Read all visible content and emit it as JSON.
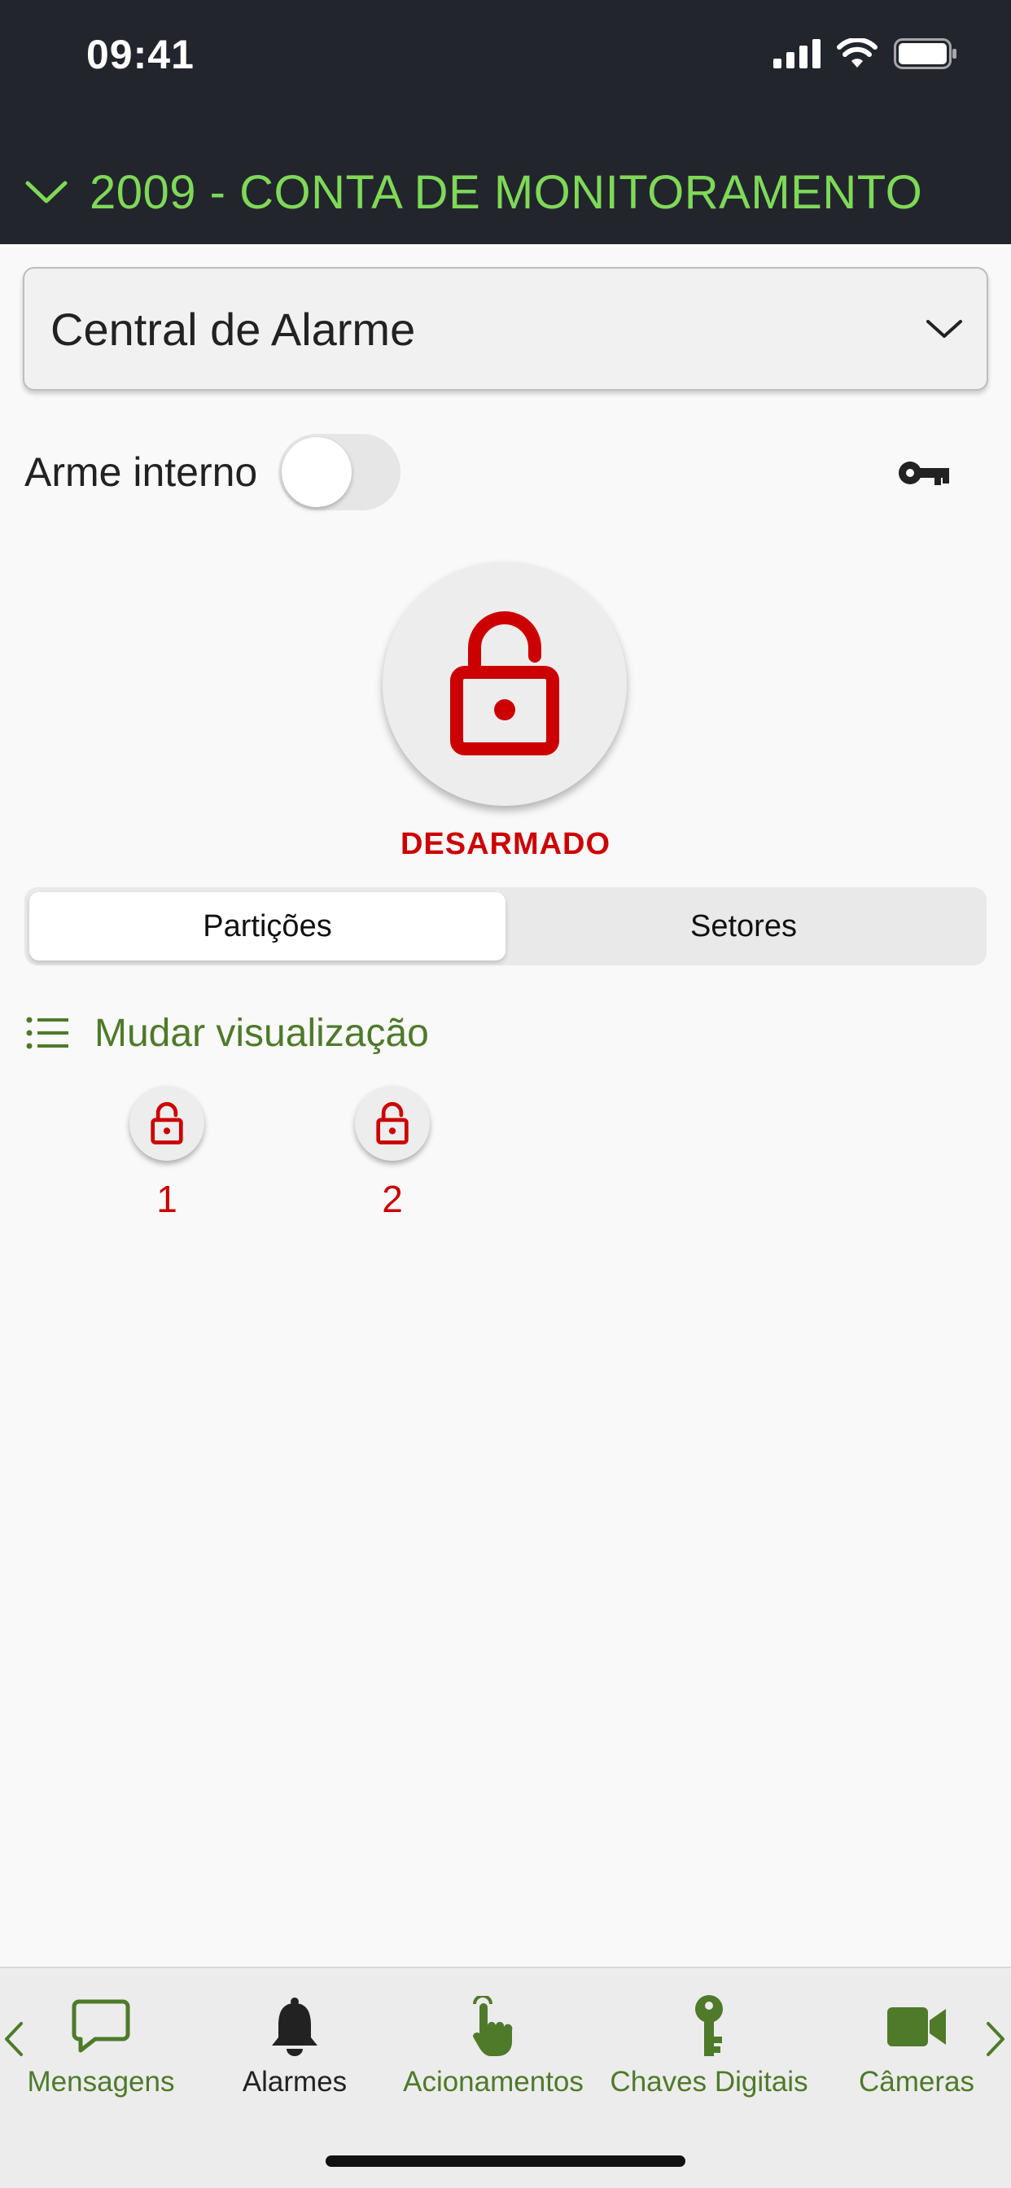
{
  "status_bar": {
    "time": "09:41"
  },
  "header": {
    "account_title": "2009 - CONTA DE MONITORAMENTO"
  },
  "panel_select": {
    "value": "Central de Alarme"
  },
  "arm_internal": {
    "label": "Arme interno",
    "enabled": false
  },
  "alarm_state": {
    "label": "DESARMADO",
    "color": "#cc0000"
  },
  "segments": {
    "items": [
      {
        "label": "Partições",
        "active": true
      },
      {
        "label": "Setores",
        "active": false
      }
    ]
  },
  "view_toggle": {
    "label": "Mudar visualização"
  },
  "partitions": [
    {
      "number": "1"
    },
    {
      "number": "2"
    }
  ],
  "tabs": [
    {
      "label": "Mensagens",
      "icon": "chat-bubble-icon"
    },
    {
      "label": "Alarmes",
      "icon": "bell-icon"
    },
    {
      "label": "Acionamentos",
      "icon": "hand-pointer-icon"
    },
    {
      "label": "Chaves Digitais",
      "icon": "key-icon"
    },
    {
      "label": "Câmeras",
      "icon": "video-camera-icon"
    }
  ],
  "colors": {
    "accent_green": "#7ed957",
    "brand_green": "#4e7a2a",
    "alarm_red": "#cc0000",
    "header_bg": "#23252d"
  }
}
